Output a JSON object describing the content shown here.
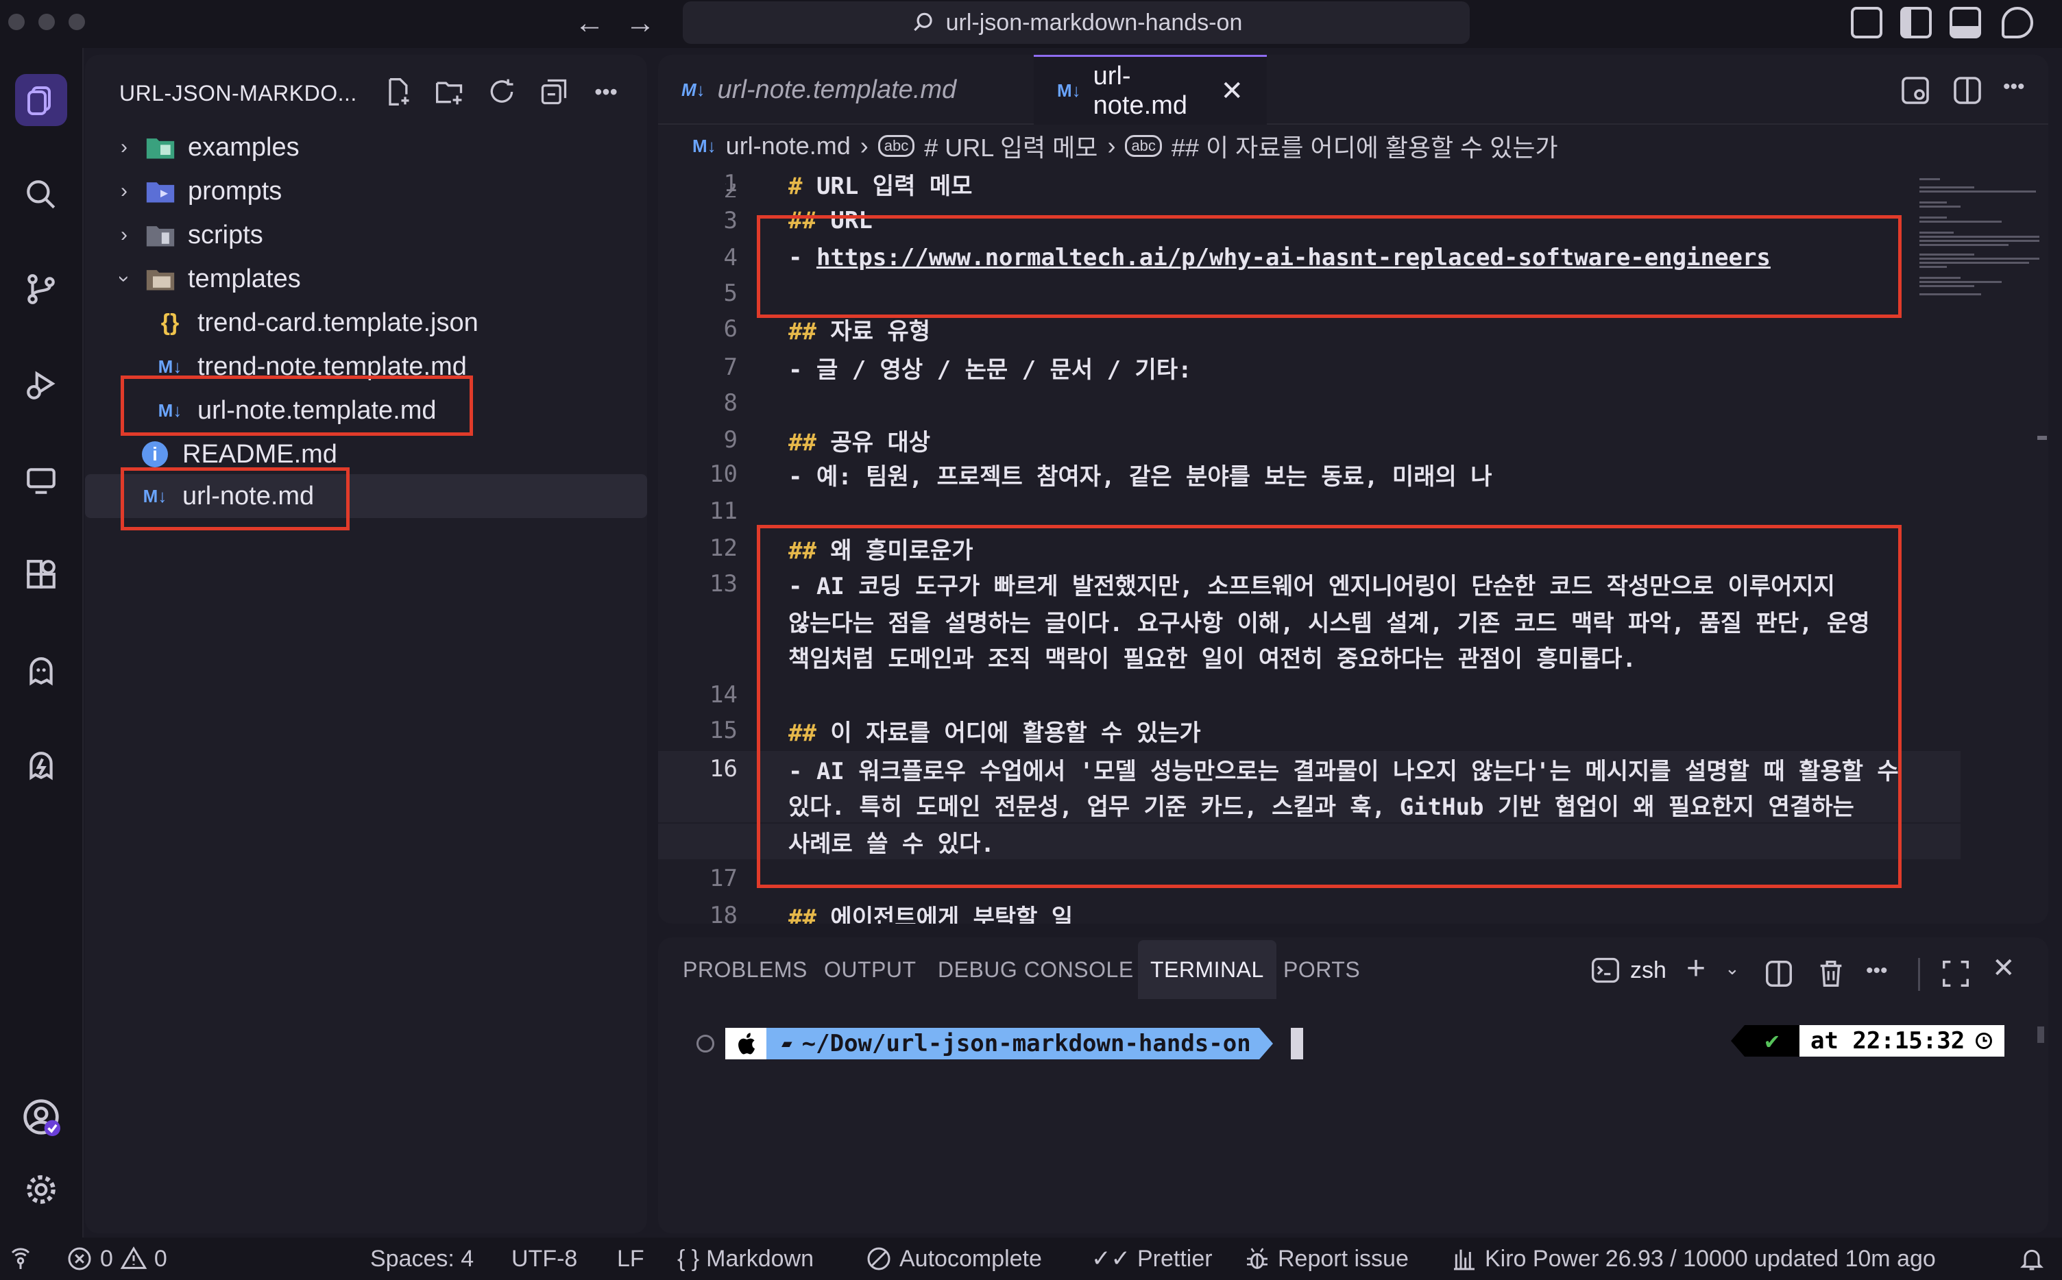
{
  "window": {
    "title": "url-json-markdown-hands-on"
  },
  "explorer": {
    "header": "URL-JSON-MARKDO...",
    "items": [
      {
        "label": "examples",
        "type": "folder",
        "expanded": false
      },
      {
        "label": "prompts",
        "type": "folder",
        "expanded": false
      },
      {
        "label": "scripts",
        "type": "folder",
        "expanded": false
      },
      {
        "label": "templates",
        "type": "folder",
        "expanded": true
      },
      {
        "label": "trend-card.template.json",
        "type": "json"
      },
      {
        "label": "trend-note.template.md",
        "type": "md"
      },
      {
        "label": "url-note.template.md",
        "type": "md"
      },
      {
        "label": "README.md",
        "type": "info"
      },
      {
        "label": "url-note.md",
        "type": "md",
        "selected": true
      }
    ],
    "md_icon": "M↓",
    "json_icon": "{}",
    "info_icon": "i"
  },
  "editor": {
    "tabs": [
      {
        "label": "url-note.template.md",
        "active": false
      },
      {
        "label": "url-note.md",
        "active": true
      }
    ],
    "breadcrumb": {
      "file": "url-note.md",
      "h1": "# URL 입력 메모",
      "h2": "## 이 자료를 어디에 활용할 수 있는가",
      "sym_icon": "abc"
    },
    "lines": [
      {
        "n": "1",
        "hash": "#",
        "text": " URL 입력 메모"
      },
      {
        "n": "2",
        "hash": "",
        "text": ""
      },
      {
        "n": "3",
        "hash": "##",
        "text": " URL"
      },
      {
        "n": "4",
        "hash": "",
        "text": "- ",
        "link": "https://www.normaltech.ai/p/why-ai-hasnt-replaced-software-engineers"
      },
      {
        "n": "5",
        "hash": "",
        "text": ""
      },
      {
        "n": "6",
        "hash": "##",
        "text": " 자료 유형"
      },
      {
        "n": "7",
        "hash": "",
        "text": "- 글 / 영상 / 논문 / 문서 / 기타:"
      },
      {
        "n": "8",
        "hash": "",
        "text": ""
      },
      {
        "n": "9",
        "hash": "##",
        "text": " 공유 대상"
      },
      {
        "n": "10",
        "hash": "",
        "text": "- 예: 팀원, 프로젝트 참여자, 같은 분야를 보는 동료, 미래의 나"
      },
      {
        "n": "11",
        "hash": "",
        "text": ""
      },
      {
        "n": "12",
        "hash": "##",
        "text": " 왜 흥미로운가"
      },
      {
        "n": "13",
        "hash": "",
        "text": "- AI 코딩 도구가 빠르게 발전했지만, 소프트웨어 엔지니어링이 단순한 코드 작성만으로 이루어지지"
      },
      {
        "n": "",
        "hash": "",
        "text": "않는다는 점을 설명하는 글이다. 요구사항 이해, 시스템 설계, 기존 코드 맥락 파악, 품질 판단, 운영"
      },
      {
        "n": "",
        "hash": "",
        "text": "책임처럼 도메인과 조직 맥락이 필요한 일이 여전히 중요하다는 관점이 흥미롭다."
      },
      {
        "n": "14",
        "hash": "",
        "text": ""
      },
      {
        "n": "15",
        "hash": "##",
        "text": " 이 자료를 어디에 활용할 수 있는가"
      },
      {
        "n": "16",
        "hash": "",
        "text": "- AI 워크플로우 수업에서 '모델 성능만으로는 결과물이 나오지 않는다'는 메시지를 설명할 때 활용할 수"
      },
      {
        "n": "",
        "hash": "",
        "text": "있다. 특히 도메인 전문성, 업무 기준 카드, 스킬과 훅, GitHub 기반 협업이 왜 필요한지 연결하는"
      },
      {
        "n": "",
        "hash": "",
        "text": "사례로 쓸 수 있다."
      },
      {
        "n": "17",
        "hash": "",
        "text": ""
      },
      {
        "n": "18",
        "hash": "##",
        "text": " 에이전트에게 부탁할 일"
      }
    ]
  },
  "panel": {
    "tabs": [
      "PROBLEMS",
      "OUTPUT",
      "DEBUG CONSOLE",
      "TERMINAL",
      "PORTS"
    ],
    "active_tab": "TERMINAL",
    "shell": "zsh",
    "prompt_path": "~/Dow/url-json-markdown-hands-on",
    "prompt_ok": "✔",
    "prompt_time": "at 22:15:32"
  },
  "statusbar": {
    "errors": "0",
    "warnings": "0",
    "spaces": "Spaces: 4",
    "encoding": "UTF-8",
    "eol": "LF",
    "language": "Markdown",
    "autocomplete": "Autocomplete",
    "prettier": "Prettier",
    "report": "Report issue",
    "kiro": "Kiro Power 26.93 / 10000 updated 10m ago"
  },
  "colors": {
    "accent": "#8e6cf0",
    "highlight_box": "#e13b2a",
    "heading_hash": "#e6b84a",
    "md_icon": "#6aa5ff",
    "prompt_path_bg": "#7ab3f5"
  }
}
